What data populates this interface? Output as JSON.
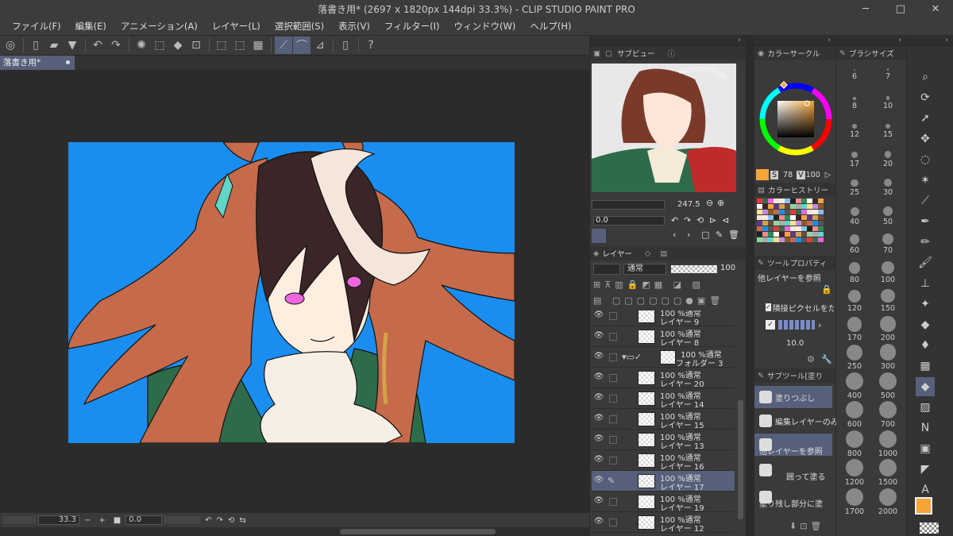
{
  "window": {
    "title": "落書き用* (2697 x 1820px 144dpi 33.3%)  - CLIP STUDIO PAINT PRO",
    "min": "─",
    "max": "□",
    "close": "✕"
  },
  "menu": [
    "ファイル(F)",
    "編集(E)",
    "アニメーション(A)",
    "レイヤー(L)",
    "選択範囲(S)",
    "表示(V)",
    "フィルター(I)",
    "ウィンドウ(W)",
    "ヘルプ(H)"
  ],
  "doc_tab": {
    "label": "落書き用*"
  },
  "canvas_status": {
    "zoom": "33.3",
    "minus": "−",
    "plus": "+",
    "rotation": "0.0"
  },
  "navigator": {
    "tab_label": "サブビュー",
    "zoom_value": "247.5",
    "rotation_value": "0.0"
  },
  "layer_panel": {
    "tab_label": "レイヤー",
    "blend_mode": "通常",
    "opacity": "100",
    "layers": [
      {
        "line1": "100 %通常",
        "line2": "レイヤー 9",
        "kind": "normal"
      },
      {
        "line1": "100 %通常",
        "line2": "レイヤー 8",
        "kind": "normal"
      },
      {
        "line1": "100 %通常",
        "line2": "フォルダー 3",
        "kind": "folder"
      },
      {
        "line1": "100 %通常",
        "line2": "レイヤー 20",
        "kind": "normal"
      },
      {
        "line1": "100 %通常",
        "line2": "レイヤー 14",
        "kind": "normal"
      },
      {
        "line1": "100 %通常",
        "line2": "レイヤー 15",
        "kind": "normal"
      },
      {
        "line1": "100 %通常",
        "line2": "レイヤー 13",
        "kind": "normal"
      },
      {
        "line1": "100 %通常",
        "line2": "レイヤー 16",
        "kind": "normal"
      },
      {
        "line1": "100 %通常",
        "line2": "レイヤー 17",
        "kind": "selected"
      },
      {
        "line1": "100 %通常",
        "line2": "レイヤー 19",
        "kind": "normal"
      },
      {
        "line1": "100 %通常",
        "line2": "レイヤー 12",
        "kind": "normal"
      }
    ]
  },
  "color_circle": {
    "tab_label": "カラーサークル",
    "s_label": "S",
    "s_value": "78",
    "v_label": "V",
    "v_value": "100"
  },
  "color_history": {
    "tab_label": "カラーヒストリー"
  },
  "tool_property": {
    "tab_label": "ツールプロパティ",
    "refer_label": "他レイヤーを参照",
    "adjacent_label": "隣接ピクセルをた",
    "value": "10.0"
  },
  "subtool": {
    "tab_label": "サブツール[塗り",
    "items": [
      "塗りつぶし",
      "編集レイヤーのみ",
      "他レイヤーを参照",
      "囲って塗る",
      "塗り残し部分に塗"
    ]
  },
  "brush_size": {
    "tab_label": "ブラシサイズ",
    "sizes": [
      "6",
      "7",
      "8",
      "10",
      "12",
      "15",
      "17",
      "20",
      "25",
      "30",
      "40",
      "50",
      "60",
      "70",
      "80",
      "100",
      "120",
      "150",
      "170",
      "200",
      "250",
      "300",
      "400",
      "500",
      "600",
      "700",
      "800",
      "1000",
      "1200",
      "1500",
      "1700",
      "2000"
    ]
  },
  "colors": {
    "bg": "#2b2b2b",
    "panel": "#3a3a3a",
    "accent": "#56607a",
    "canvas_blue": "#1a8ef0",
    "hair": "#c56a4a",
    "dark_hair": "#3a2626",
    "skin": "#fdeee0",
    "coat": "#2e6b4a",
    "main_color": "#f4a53a"
  }
}
